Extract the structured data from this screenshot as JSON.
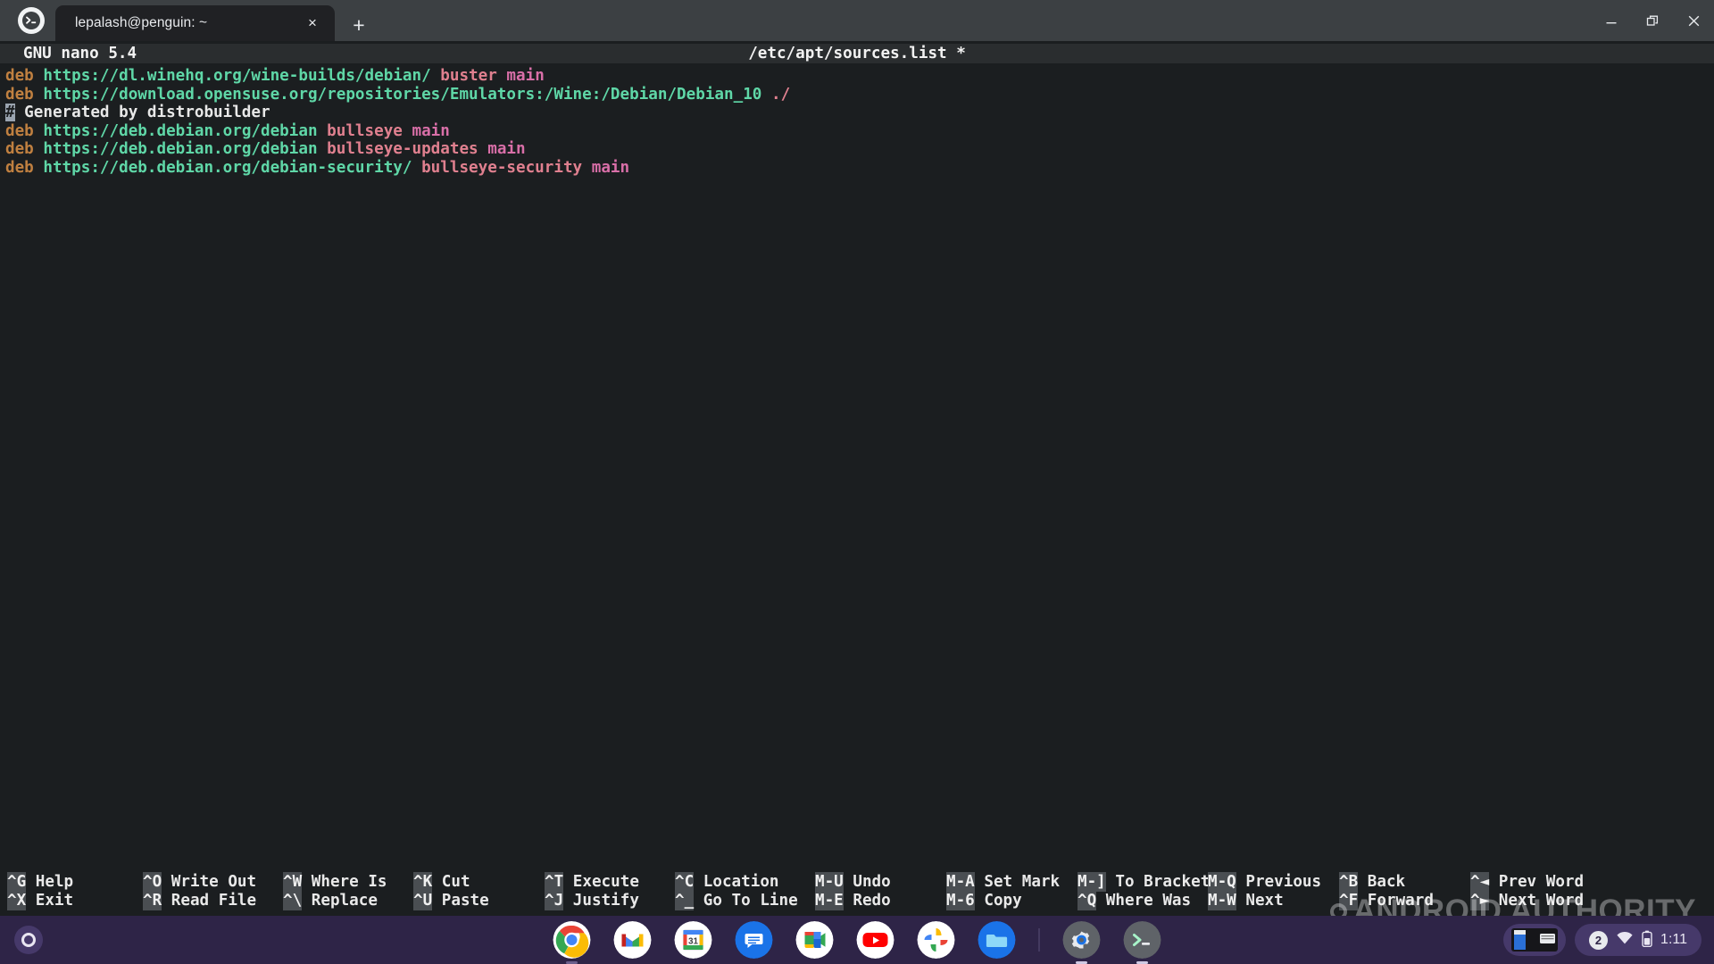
{
  "window": {
    "app_icon": "terminal-icon",
    "tab": {
      "title": "lepalash@penguin: ~",
      "close_label": "×"
    },
    "new_tab_label": "+",
    "controls": {
      "minimize": "minimize-icon",
      "maximize": "restore-icon",
      "close": "close-icon"
    }
  },
  "nano": {
    "version": "GNU nano 5.4",
    "filename": "/etc/apt/sources.list *",
    "lines": [
      {
        "tokens": [
          {
            "text": "deb ",
            "cls": "tok-deb"
          },
          {
            "text": "https://dl.winehq.org/wine-builds/debian/ ",
            "cls": "tok-url"
          },
          {
            "text": "buster ",
            "cls": "tok-dist"
          },
          {
            "text": "main",
            "cls": "tok-comp"
          }
        ]
      },
      {
        "tokens": [
          {
            "text": "deb ",
            "cls": "tok-deb"
          },
          {
            "text": "https://download.opensuse.org/repositories/Emulators:/Wine:/Debian/Debian_10 ",
            "cls": "tok-url"
          },
          {
            "text": "./",
            "cls": "tok-dist"
          }
        ]
      },
      {
        "tokens": [
          {
            "text": "#",
            "cls": "tok-hash"
          },
          {
            "text": " Generated by distrobuilder",
            "cls": "tok-comment"
          }
        ]
      },
      {
        "tokens": [
          {
            "text": "deb ",
            "cls": "tok-deb"
          },
          {
            "text": "https://deb.debian.org/debian ",
            "cls": "tok-url"
          },
          {
            "text": "bullseye ",
            "cls": "tok-dist"
          },
          {
            "text": "main",
            "cls": "tok-comp"
          }
        ]
      },
      {
        "tokens": [
          {
            "text": "deb ",
            "cls": "tok-deb"
          },
          {
            "text": "https://deb.debian.org/debian ",
            "cls": "tok-url"
          },
          {
            "text": "bullseye-updates ",
            "cls": "tok-dist"
          },
          {
            "text": "main",
            "cls": "tok-comp"
          }
        ]
      },
      {
        "tokens": [
          {
            "text": "deb ",
            "cls": "tok-deb"
          },
          {
            "text": "https://deb.debian.org/debian-security/ ",
            "cls": "tok-url"
          },
          {
            "text": "bullseye-security ",
            "cls": "tok-dist"
          },
          {
            "text": "main",
            "cls": "tok-comp"
          }
        ]
      }
    ],
    "shortcuts": [
      {
        "col": 8,
        "row": 0,
        "key": "^G",
        "label": " Help"
      },
      {
        "col": 8,
        "row": 1,
        "key": "^X",
        "label": " Exit"
      },
      {
        "col": 160,
        "row": 0,
        "key": "^O",
        "label": " Write Out"
      },
      {
        "col": 160,
        "row": 1,
        "key": "^R",
        "label": " Read File"
      },
      {
        "col": 317,
        "row": 0,
        "key": "^W",
        "label": " Where Is"
      },
      {
        "col": 317,
        "row": 1,
        "key": "^\\",
        "label": " Replace"
      },
      {
        "col": 463,
        "row": 0,
        "key": "^K",
        "label": " Cut"
      },
      {
        "col": 463,
        "row": 1,
        "key": "^U",
        "label": " Paste"
      },
      {
        "col": 610,
        "row": 0,
        "key": "^T",
        "label": " Execute"
      },
      {
        "col": 610,
        "row": 1,
        "key": "^J",
        "label": " Justify"
      },
      {
        "col": 756,
        "row": 0,
        "key": "^C",
        "label": " Location"
      },
      {
        "col": 756,
        "row": 1,
        "key": "^_",
        "label": " Go To Line"
      },
      {
        "col": 913,
        "row": 0,
        "key": "M-U",
        "label": " Undo"
      },
      {
        "col": 913,
        "row": 1,
        "key": "M-E",
        "label": " Redo"
      },
      {
        "col": 1060,
        "row": 0,
        "key": "M-A",
        "label": " Set Mark"
      },
      {
        "col": 1060,
        "row": 1,
        "key": "M-6",
        "label": " Copy"
      },
      {
        "col": 1207,
        "row": 0,
        "key": "M-]",
        "label": " To Bracket"
      },
      {
        "col": 1207,
        "row": 1,
        "key": "^Q",
        "label": " Where Was"
      },
      {
        "col": 1353,
        "row": 0,
        "key": "M-Q",
        "label": " Previous"
      },
      {
        "col": 1353,
        "row": 1,
        "key": "M-W",
        "label": " Next"
      },
      {
        "col": 1500,
        "row": 0,
        "key": "^B",
        "label": " Back"
      },
      {
        "col": 1500,
        "row": 1,
        "key": "^F",
        "label": " Forward"
      },
      {
        "col": 1647,
        "row": 0,
        "key": "^◄",
        "label": " Prev Word"
      },
      {
        "col": 1647,
        "row": 1,
        "key": "^►",
        "label": " Next Word"
      }
    ]
  },
  "watermark": {
    "text": "ANDROID AUTHORITY"
  },
  "shelf": {
    "launcher": "launcher-icon",
    "apps": [
      {
        "name": "chrome",
        "active": true
      },
      {
        "name": "gmail",
        "active": false
      },
      {
        "name": "calendar",
        "active": false,
        "badge": "31"
      },
      {
        "name": "messages",
        "active": false
      },
      {
        "name": "meet",
        "active": false
      },
      {
        "name": "youtube",
        "active": false
      },
      {
        "name": "photos",
        "active": false
      },
      {
        "name": "files",
        "active": false
      },
      {
        "name": "settings",
        "active": true
      },
      {
        "name": "terminal",
        "active": true
      }
    ],
    "tray": {
      "notification_count": "2",
      "wifi": "wifi-icon",
      "battery": "battery-icon",
      "time": "1:11"
    }
  }
}
